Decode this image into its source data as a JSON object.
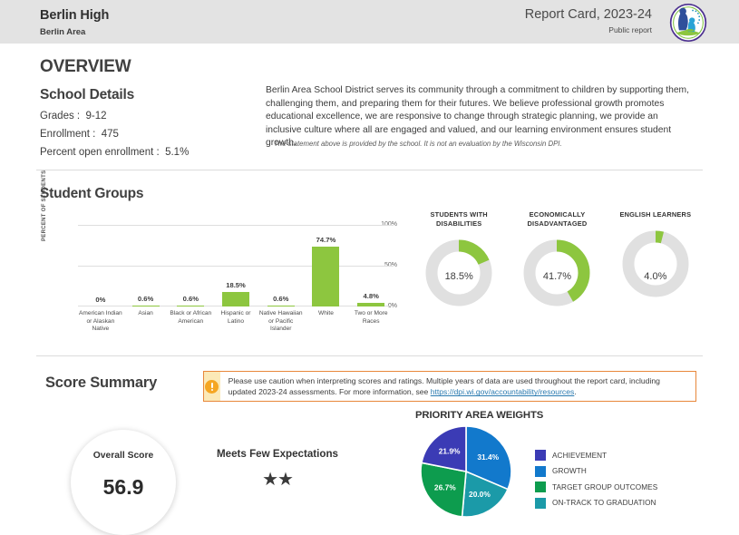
{
  "header": {
    "school_name": "Berlin High",
    "district_name": "Berlin Area",
    "report_card_title": "Report Card, 2023-24",
    "report_type": "Public report",
    "logo_icon": "dpi-seal-icon"
  },
  "overview": {
    "section_title": "OVERVIEW",
    "school_details_title": "School Details",
    "details": [
      {
        "label": "Grades :",
        "value": "9-12"
      },
      {
        "label": "Enrollment :",
        "value": "475"
      },
      {
        "label": "Percent open enrollment :",
        "value": "5.1%"
      }
    ],
    "mission_statement": "Berlin Area School District serves its community through a commitment to children by supporting them, challenging them, and preparing them for their futures. We believe professional growth promotes educational excellence, we are responsive to change through strategic planning, we provide an inclusive culture where all are engaged and valued, and our learning environment ensures student growth.",
    "mission_note": "The statement above is provided by the school. It is not an evaluation by the Wisconsin DPI."
  },
  "student_groups": {
    "section_title": "Student Groups",
    "donuts": [
      {
        "title": "STUDENTS WITH DISABILITIES",
        "value": "18.5%",
        "percent": 18.5
      },
      {
        "title": "ECONOMICALLY DISADVANTAGED",
        "value": "41.7%",
        "percent": 41.7
      },
      {
        "title": "ENGLISH LEARNERS",
        "value": "4.0%",
        "percent": 4.0
      }
    ]
  },
  "score_summary": {
    "section_title": "Score Summary",
    "alert": {
      "icon": "exclamation-icon",
      "text_before_link": "Please use caution when interpreting scores and ratings. Multiple years of data are used throughout the report card, including updated 2023-24 assessments. For more information, see ",
      "link_text": "https://dpi.wi.gov/accountability/resources",
      "text_after_link": "."
    },
    "overall_score_label": "Overall Score",
    "overall_score_value": "56.9",
    "rating_label": "Meets Few Expectations",
    "stars_filled": 2,
    "star_glyph": "★",
    "pie_title": "PRIORITY AREA WEIGHTS"
  },
  "chart_data": [
    {
      "type": "bar",
      "title": "Student Groups",
      "xlabel": "",
      "ylabel": "PERCENT OF STUDENTS",
      "ylim": [
        0,
        100
      ],
      "yticks": [
        "0%",
        "50%",
        "100%"
      ],
      "grid": true,
      "categories": [
        "American Indian or Alaskan Native",
        "Asian",
        "Black or African American",
        "Hispanic or Latino",
        "Native Hawaiian or Pacific Islander",
        "White",
        "Two or More Races"
      ],
      "values": [
        0,
        0.6,
        0.6,
        18.5,
        0.6,
        74.7,
        4.8
      ],
      "data_labels": [
        "0%",
        "0.6%",
        "0.6%",
        "18.5%",
        "0.6%",
        "74.7%",
        "4.8%"
      ],
      "bar_color": "#8dc63f"
    },
    {
      "type": "pie",
      "title": "PRIORITY AREA WEIGHTS",
      "legend_position": "right",
      "categories": [
        "ACHIEVEMENT",
        "GROWTH",
        "TARGET GROUP OUTCOMES",
        "ON-TRACK TO GRADUATION"
      ],
      "values": [
        21.9,
        31.4,
        26.7,
        20.0
      ],
      "data_labels": [
        "21.9%",
        "31.4%",
        "26.7%",
        "20.0%"
      ],
      "colors": [
        "#3b3bb5",
        "#1279cc",
        "#0d9c4e",
        "#1b9aa8"
      ]
    },
    {
      "type": "pie",
      "title": "STUDENTS WITH DISABILITIES",
      "categories": [
        "value",
        "remainder"
      ],
      "values": [
        18.5,
        81.5
      ],
      "data_labels": [
        "18.5%",
        ""
      ],
      "colors": [
        "#8dc63f",
        "#e0e0e0"
      ]
    },
    {
      "type": "pie",
      "title": "ECONOMICALLY DISADVANTAGED",
      "categories": [
        "value",
        "remainder"
      ],
      "values": [
        41.7,
        58.3
      ],
      "data_labels": [
        "41.7%",
        ""
      ],
      "colors": [
        "#8dc63f",
        "#e0e0e0"
      ]
    },
    {
      "type": "pie",
      "title": "ENGLISH LEARNERS",
      "categories": [
        "value",
        "remainder"
      ],
      "values": [
        4.0,
        96.0
      ],
      "data_labels": [
        "4.0%",
        ""
      ],
      "colors": [
        "#8dc63f",
        "#e0e0e0"
      ]
    }
  ]
}
